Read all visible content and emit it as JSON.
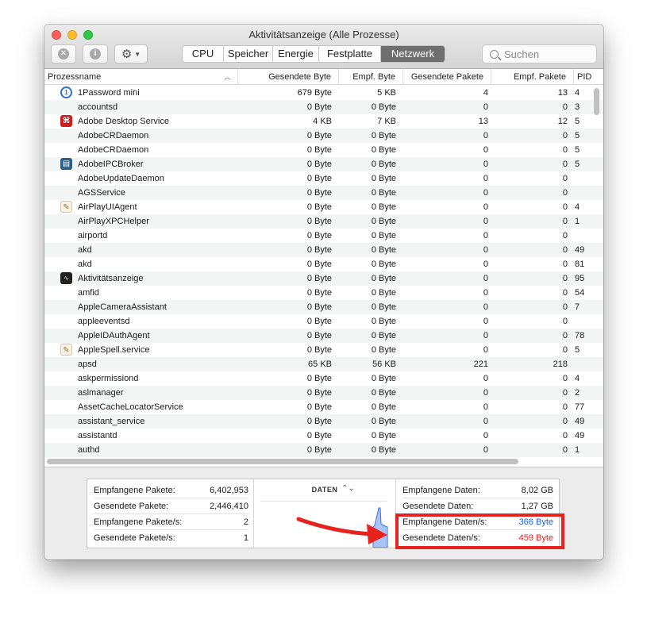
{
  "window": {
    "title": "Aktivitätsanzeige (Alle Prozesse)"
  },
  "toolbar": {
    "stop_icon": "xmark-circle-icon",
    "info_icon": "info-circle-icon",
    "action_icon": "gear-icon",
    "tabs": [
      {
        "label": "CPU",
        "active": false
      },
      {
        "label": "Speicher",
        "active": false
      },
      {
        "label": "Energie",
        "active": false
      },
      {
        "label": "Festplatte",
        "active": false
      },
      {
        "label": "Netzwerk",
        "active": true
      }
    ],
    "search_placeholder": "Suchen"
  },
  "columns": {
    "name": "Prozessname",
    "sent_bytes": "Gesendete Byte",
    "recv_bytes": "Empf. Byte",
    "sent_packets": "Gesendete Pakete",
    "recv_packets": "Empf. Pakete",
    "pid": "PID"
  },
  "processes": [
    {
      "name": "1Password mini",
      "icon": "onepassword-icon",
      "sent": "679 Byte",
      "recv": "5 KB",
      "spk": "4",
      "rpk": "13",
      "pid": "4"
    },
    {
      "name": "accountsd",
      "icon": "",
      "sent": "0 Byte",
      "recv": "0 Byte",
      "spk": "0",
      "rpk": "0",
      "pid": "3"
    },
    {
      "name": "Adobe Desktop Service",
      "icon": "adobe-icon",
      "sent": "4 KB",
      "recv": "7 KB",
      "spk": "13",
      "rpk": "12",
      "pid": "5"
    },
    {
      "name": "AdobeCRDaemon",
      "icon": "",
      "sent": "0 Byte",
      "recv": "0 Byte",
      "spk": "0",
      "rpk": "0",
      "pid": "5"
    },
    {
      "name": "AdobeCRDaemon",
      "icon": "",
      "sent": "0 Byte",
      "recv": "0 Byte",
      "spk": "0",
      "rpk": "0",
      "pid": "5"
    },
    {
      "name": "AdobeIPCBroker",
      "icon": "ipc-icon",
      "sent": "0 Byte",
      "recv": "0 Byte",
      "spk": "0",
      "rpk": "0",
      "pid": "5"
    },
    {
      "name": "AdobeUpdateDaemon",
      "icon": "",
      "sent": "0 Byte",
      "recv": "0 Byte",
      "spk": "0",
      "rpk": "0",
      "pid": ""
    },
    {
      "name": "AGSService",
      "icon": "",
      "sent": "0 Byte",
      "recv": "0 Byte",
      "spk": "0",
      "rpk": "0",
      "pid": ""
    },
    {
      "name": "AirPlayUIAgent",
      "icon": "document-icon",
      "sent": "0 Byte",
      "recv": "0 Byte",
      "spk": "0",
      "rpk": "0",
      "pid": "4"
    },
    {
      "name": "AirPlayXPCHelper",
      "icon": "",
      "sent": "0 Byte",
      "recv": "0 Byte",
      "spk": "0",
      "rpk": "0",
      "pid": "1"
    },
    {
      "name": "airportd",
      "icon": "",
      "sent": "0 Byte",
      "recv": "0 Byte",
      "spk": "0",
      "rpk": "0",
      "pid": ""
    },
    {
      "name": "akd",
      "icon": "",
      "sent": "0 Byte",
      "recv": "0 Byte",
      "spk": "0",
      "rpk": "0",
      "pid": "49"
    },
    {
      "name": "akd",
      "icon": "",
      "sent": "0 Byte",
      "recv": "0 Byte",
      "spk": "0",
      "rpk": "0",
      "pid": "81"
    },
    {
      "name": "Aktivitätsanzeige",
      "icon": "activity-monitor-icon",
      "sent": "0 Byte",
      "recv": "0 Byte",
      "spk": "0",
      "rpk": "0",
      "pid": "95"
    },
    {
      "name": "amfid",
      "icon": "",
      "sent": "0 Byte",
      "recv": "0 Byte",
      "spk": "0",
      "rpk": "0",
      "pid": "54"
    },
    {
      "name": "AppleCameraAssistant",
      "icon": "",
      "sent": "0 Byte",
      "recv": "0 Byte",
      "spk": "0",
      "rpk": "0",
      "pid": "7"
    },
    {
      "name": "appleeventsd",
      "icon": "",
      "sent": "0 Byte",
      "recv": "0 Byte",
      "spk": "0",
      "rpk": "0",
      "pid": ""
    },
    {
      "name": "AppleIDAuthAgent",
      "icon": "",
      "sent": "0 Byte",
      "recv": "0 Byte",
      "spk": "0",
      "rpk": "0",
      "pid": "78"
    },
    {
      "name": "AppleSpell.service",
      "icon": "document-icon",
      "sent": "0 Byte",
      "recv": "0 Byte",
      "spk": "0",
      "rpk": "0",
      "pid": "5"
    },
    {
      "name": "apsd",
      "icon": "",
      "sent": "65 KB",
      "recv": "56 KB",
      "spk": "221",
      "rpk": "218",
      "pid": ""
    },
    {
      "name": "askpermissiond",
      "icon": "",
      "sent": "0 Byte",
      "recv": "0 Byte",
      "spk": "0",
      "rpk": "0",
      "pid": "4"
    },
    {
      "name": "aslmanager",
      "icon": "",
      "sent": "0 Byte",
      "recv": "0 Byte",
      "spk": "0",
      "rpk": "0",
      "pid": "2"
    },
    {
      "name": "AssetCacheLocatorService",
      "icon": "",
      "sent": "0 Byte",
      "recv": "0 Byte",
      "spk": "0",
      "rpk": "0",
      "pid": "77"
    },
    {
      "name": "assistant_service",
      "icon": "",
      "sent": "0 Byte",
      "recv": "0 Byte",
      "spk": "0",
      "rpk": "0",
      "pid": "49"
    },
    {
      "name": "assistantd",
      "icon": "",
      "sent": "0 Byte",
      "recv": "0 Byte",
      "spk": "0",
      "rpk": "0",
      "pid": "49"
    },
    {
      "name": "authd",
      "icon": "",
      "sent": "0 Byte",
      "recv": "0 Byte",
      "spk": "0",
      "rpk": "0",
      "pid": "1"
    }
  ],
  "summary": {
    "left": [
      {
        "label": "Empfangene Pakete:",
        "value": "6,402,953"
      },
      {
        "label": "Gesendete Pakete:",
        "value": "2,446,410"
      },
      {
        "label": "Empfangene Pakete/s:",
        "value": "2"
      },
      {
        "label": "Gesendete Pakete/s:",
        "value": "1"
      }
    ],
    "graph_label": "DATEN",
    "graph_toggle": "⌃",
    "right": [
      {
        "label": "Empfangene Daten:",
        "value": "8,02 GB",
        "color": ""
      },
      {
        "label": "Gesendete Daten:",
        "value": "1,27 GB",
        "color": ""
      },
      {
        "label": "Empfangene Daten/s:",
        "value": "366 Byte",
        "color": "#1f5cdb"
      },
      {
        "label": "Gesendete Daten/s:",
        "value": "459 Byte",
        "color": "#e8231e"
      }
    ]
  },
  "colors": {
    "annotation_red": "#e8231e",
    "received_blue": "#1f5cdb",
    "active_tab": "#6f6f6f"
  }
}
